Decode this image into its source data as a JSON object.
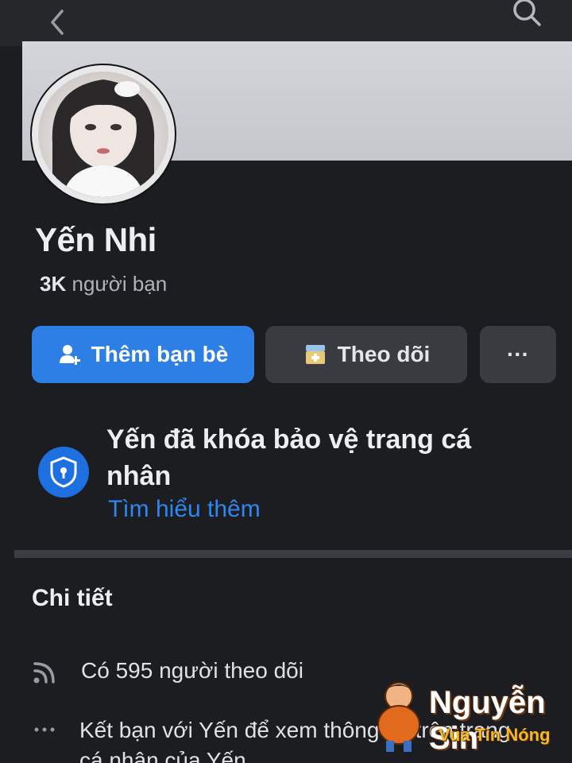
{
  "profile": {
    "name": "Yến Nhi",
    "friends_count": "3K",
    "friends_label": "người bạn"
  },
  "actions": {
    "add_friend": "Thêm bạn bè",
    "follow": "Theo dõi",
    "more": "···"
  },
  "privacy": {
    "title": "Yến đã khóa bảo vệ trang cá nhân",
    "learn_more": "Tìm hiểu thêm"
  },
  "details": {
    "title": "Chi tiết",
    "followers": "Có 595 người theo dõi",
    "befriend_note": "Kết bạn với Yến để xem thông tin trên trang cá nhân của Yến."
  },
  "watermark": {
    "title": "Nguyễn Sin",
    "subtitle": "Vua Tin Nóng"
  },
  "colors": {
    "primary": "#2d7fe6",
    "link": "#2f86f0",
    "background": "#1c1d21"
  },
  "icons": [
    "back-arrow-icon",
    "search-icon",
    "add-friend-icon",
    "follow-icon",
    "more-icon",
    "shield-lock-icon",
    "rss-icon",
    "dots-icon"
  ]
}
